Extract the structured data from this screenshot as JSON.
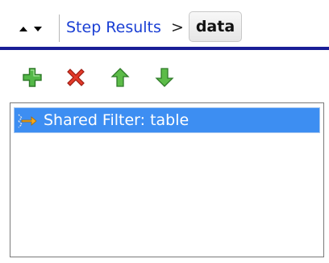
{
  "breadcrumb": {
    "link_label": "Step Results",
    "separator": ">",
    "current_label": "data"
  },
  "toolbar": {
    "add_icon": "green-plus-icon",
    "delete_icon": "red-x-icon",
    "move_up_icon": "green-up-arrow-icon",
    "move_down_icon": "green-down-arrow-icon"
  },
  "list": {
    "items": [
      {
        "label": "Shared Filter: table",
        "icon": "filter-arrow-icon",
        "selected": true
      }
    ]
  },
  "colors": {
    "accent_rule": "#1a1e96",
    "selection": "#3d8ef2",
    "link": "#1a3fd4"
  }
}
